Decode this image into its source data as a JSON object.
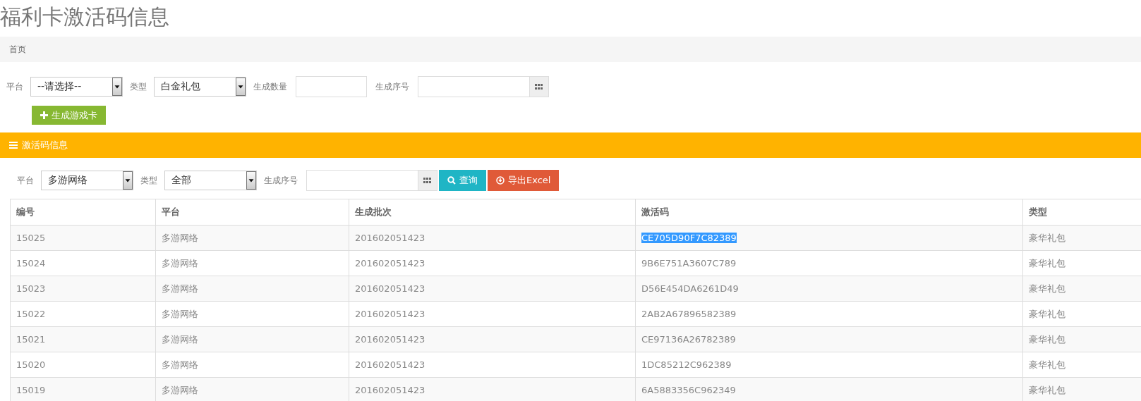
{
  "page_title": "福利卡激活码信息",
  "breadcrumb": [
    "首页"
  ],
  "generate_form": {
    "fields": [
      {
        "kind": "select",
        "label": "平台",
        "value": "--请选择--"
      },
      {
        "kind": "select",
        "label": "类型",
        "value": "白金礼包"
      },
      {
        "kind": "input",
        "label": "生成数量"
      },
      {
        "kind": "grid-input",
        "label": "生成序号"
      }
    ],
    "button": "生成游戏卡"
  },
  "panel": {
    "title": "激活码信息",
    "filters": [
      {
        "kind": "select",
        "label": "平台",
        "value": "多游网络"
      },
      {
        "kind": "select",
        "label": "类型",
        "value": "全部"
      },
      {
        "kind": "grid-input",
        "label": "生成序号"
      }
    ],
    "buttons": [
      {
        "kind": "search",
        "label": "查询"
      },
      {
        "kind": "export",
        "label": "导出Excel"
      }
    ],
    "table": {
      "columns": [
        "编号",
        "平台",
        "生成批次",
        "激活码",
        "类型"
      ],
      "rows": [
        {
          "cells": [
            "15025",
            "多游网络",
            "201602051423",
            "CE705D90F7C82389",
            "豪华礼包"
          ],
          "code_highlighted": true
        },
        {
          "cells": [
            "15024",
            "多游网络",
            "201602051423",
            "9B6E751A3607C789",
            "豪华礼包"
          ],
          "code_highlighted": false
        },
        {
          "cells": [
            "15023",
            "多游网络",
            "201602051423",
            "D56E454DA6261D49",
            "豪华礼包"
          ],
          "code_highlighted": false
        },
        {
          "cells": [
            "15022",
            "多游网络",
            "201602051423",
            "2AB2A67896582389",
            "豪华礼包"
          ],
          "code_highlighted": false
        },
        {
          "cells": [
            "15021",
            "多游网络",
            "201602051423",
            "CE97136A26782389",
            "豪华礼包"
          ],
          "code_highlighted": false
        },
        {
          "cells": [
            "15020",
            "多游网络",
            "201602051423",
            "1DC85212C962389",
            "豪华礼包"
          ],
          "code_highlighted": false
        },
        {
          "cells": [
            "15019",
            "多游网络",
            "201602051423",
            "6A5883356C962349",
            "豪华礼包"
          ],
          "code_highlighted": false
        }
      ]
    }
  }
}
